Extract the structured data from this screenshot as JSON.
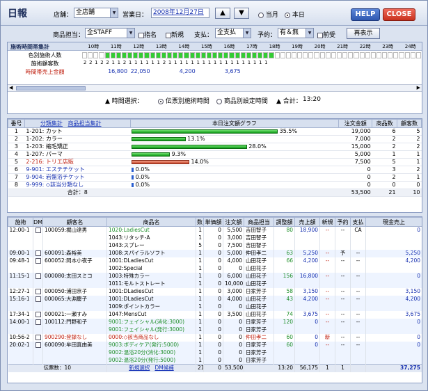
{
  "header": {
    "title": "日報",
    "store_label": "店舗：",
    "store_value": "全店舗",
    "business_day_label": "営業日：",
    "business_day_value": "2008年12月27日",
    "up_arrow": "▲",
    "down_arrow": "▼",
    "radio_month": "当月",
    "radio_today": "本日",
    "help_label": "HELP",
    "close_label": "CLOSE"
  },
  "filters": {
    "product_staff_label": "商品担当：",
    "product_staff_value": "全STAFF",
    "shimei_label": "指名",
    "shinki_label": "新規",
    "payment_label": "支払：",
    "payment_value": "全支払",
    "reserve_label": "予約：",
    "reserve_value": "有＆無",
    "maeuke_label": "前受",
    "redisplay_label": "再表示"
  },
  "timeline": {
    "title": "施術時間帯集計",
    "hours": [
      "10時",
      "11時",
      "12時",
      "13時",
      "14時",
      "15時",
      "16時",
      "17時",
      "18時",
      "19時",
      "20時",
      "21時",
      "22時",
      "23時",
      "24時"
    ],
    "row_labels": [
      "色別施術人数",
      "施術顧客数",
      "時間帯売上金額"
    ],
    "occupancy": [
      0,
      0,
      0,
      0,
      2,
      2,
      2,
      2,
      2,
      2,
      2,
      2,
      2,
      2,
      2,
      2,
      2,
      1,
      1,
      1,
      1,
      1,
      1,
      1,
      1,
      1,
      1,
      1,
      1,
      1,
      1,
      1,
      1,
      1,
      0,
      0,
      0,
      0,
      0,
      0,
      0,
      0,
      0,
      0,
      0,
      0,
      0,
      0,
      0,
      0,
      0,
      0,
      0,
      0,
      0,
      0,
      0,
      0,
      0,
      0
    ],
    "customer_counts": [
      "2",
      "2",
      "1",
      "2",
      "2",
      "1",
      "1",
      "2",
      "1",
      "1",
      "1",
      "1",
      "1",
      "1",
      "2",
      "1",
      "1",
      "1",
      "1",
      "1",
      "1",
      "1",
      "1",
      "1",
      "1",
      "1",
      "1",
      "1",
      "1",
      "1",
      "1",
      "1",
      "1"
    ],
    "sales": [
      {
        "hour_index": 1,
        "value": "16,800"
      },
      {
        "hour_index": 2,
        "value": "22,050"
      },
      {
        "hour_index": 4,
        "value": "4,200"
      },
      {
        "hour_index": 6,
        "value": "3,675"
      }
    ],
    "selector_label": "▲ 時間選択：",
    "option_slip": "伝票別施術時間",
    "option_product": "商品別設定時間",
    "total_label": "▲ 合計：",
    "total_value": "13:20"
  },
  "summary": {
    "headers": [
      "番号",
      "分類集計",
      "商品担当集計",
      "本日注文額グラフ",
      "注文金額",
      "商品数",
      "顧客数"
    ],
    "rows": [
      {
        "num": "1",
        "code": "1-201:",
        "name": "カット",
        "pct": "35.5%",
        "pct_value": 35.5,
        "bar": "green",
        "amount": "19,000",
        "items": "6",
        "customers": "5",
        "color": "black"
      },
      {
        "num": "2",
        "code": "1-202:",
        "name": "カラー",
        "pct": "13.1%",
        "pct_value": 13.1,
        "bar": "green",
        "amount": "7,000",
        "items": "2",
        "customers": "2",
        "color": "black"
      },
      {
        "num": "3",
        "code": "1-203:",
        "name": "縮毛矯正",
        "pct": "28.0%",
        "pct_value": 28.0,
        "bar": "green",
        "amount": "15,000",
        "items": "2",
        "customers": "2",
        "color": "black"
      },
      {
        "num": "4",
        "code": "1-207:",
        "name": "パーマ",
        "pct": "9.3%",
        "pct_value": 9.3,
        "bar": "green",
        "amount": "5,000",
        "items": "1",
        "customers": "1",
        "color": "black"
      },
      {
        "num": "5",
        "code": "2-216:",
        "name": "トリエ店販",
        "pct": "14.0%",
        "pct_value": 14.0,
        "bar": "red",
        "amount": "7,500",
        "items": "5",
        "customers": "1",
        "color": "red"
      },
      {
        "num": "6",
        "code": "9-901:",
        "name": "エステチケット",
        "pct": "0.0%",
        "pct_value": 0,
        "bar": "blue",
        "amount": "0",
        "items": "3",
        "customers": "2",
        "color": "blue"
      },
      {
        "num": "7",
        "code": "9-904:",
        "name": "岩盤浴チケット",
        "pct": "0.0%",
        "pct_value": 0,
        "bar": "blue",
        "amount": "0",
        "items": "2",
        "customers": "1",
        "color": "blue"
      },
      {
        "num": "8",
        "code": "9-999:",
        "name": "◇該当分類なし",
        "pct": "0.0%",
        "pct_value": 0,
        "bar": "blue",
        "amount": "0",
        "items": "0",
        "customers": "0",
        "color": "blue"
      }
    ],
    "total_label": "合計：8",
    "total_amount": "53,500",
    "total_items": "21",
    "total_customers": "10"
  },
  "detail": {
    "headers": [
      "施術",
      "DM",
      "顧客名",
      "商品名",
      "数",
      "単価額",
      "注文額",
      "商品担当",
      "調整額",
      "売上額",
      "新規",
      "予約",
      "支払",
      "現金売上"
    ],
    "rows": [
      {
        "time": "12:00-1",
        "dm": true,
        "customer": "100059:梶山達男",
        "product": "1020:LadiesCut",
        "qty": "1",
        "unit": "0",
        "order": "5,500",
        "staff": "吉田智子",
        "adj": "80",
        "sales": "18,900",
        "new": "--",
        "res": "--",
        "pay": "CA",
        "cash": "0",
        "pc": "green",
        "cc": "black",
        "sc": "black",
        "bg": "#fff"
      },
      {
        "time": "",
        "dm": false,
        "customer": "",
        "product": "1043:リタッチ-A",
        "qty": "1",
        "unit": "0",
        "order": "3,000",
        "staff": "吉田智子",
        "adj": "",
        "sales": "",
        "new": "",
        "res": "",
        "pay": "",
        "cash": "",
        "pc": "black",
        "cc": "black",
        "sc": "black",
        "bg": "#fff"
      },
      {
        "time": "",
        "dm": false,
        "customer": "",
        "product": "1043:スプレー",
        "qty": "5",
        "unit": "0",
        "order": "7,500",
        "staff": "吉田智子",
        "adj": "",
        "sales": "",
        "new": "",
        "res": "",
        "pay": "",
        "cash": "",
        "pc": "black",
        "cc": "black",
        "sc": "black",
        "bg": "#fff"
      },
      {
        "time": "09:00-1",
        "dm": true,
        "customer": "600091:森裕美",
        "product": "1008:スパイラルソフト",
        "qty": "1",
        "unit": "0",
        "order": "5,000",
        "staff": "仲田孝二",
        "adj": "63",
        "sales": "5,250",
        "new": "--",
        "res": "予",
        "pay": "--",
        "cash": "5,250",
        "pc": "black",
        "cc": "black",
        "sc": "black",
        "bg": "#eef4ff"
      },
      {
        "time": "09:48-1",
        "dm": true,
        "customer": "600052:岡本小夜子",
        "product": "1001:DLadiesCut",
        "qty": "1",
        "unit": "0",
        "order": "4,000",
        "staff": "山田花子",
        "adj": "66",
        "sales": "4,200",
        "new": "--",
        "res": "--",
        "pay": "--",
        "cash": "4,200",
        "pc": "black",
        "cc": "black",
        "sc": "black",
        "bg": "#fff"
      },
      {
        "time": "",
        "dm": false,
        "customer": "",
        "product": "1002:Special",
        "qty": "1",
        "unit": "0",
        "order": "0",
        "staff": "山田花子",
        "adj": "",
        "sales": "",
        "new": "",
        "res": "",
        "pay": "",
        "cash": "",
        "pc": "black",
        "cc": "black",
        "sc": "black",
        "bg": "#fff"
      },
      {
        "time": "11:15-1",
        "dm": true,
        "customer": "000080:太田スミコ",
        "product": "1003:特殊カラー",
        "qty": "1",
        "unit": "0",
        "order": "6,000",
        "staff": "山田花子",
        "adj": "156",
        "sales": "16,800",
        "new": "--",
        "res": "--",
        "pay": "--",
        "cash": "0",
        "pc": "black",
        "cc": "black",
        "sc": "black",
        "bg": "#eef4ff"
      },
      {
        "time": "",
        "dm": false,
        "customer": "",
        "product": "1011:モルトストレート",
        "qty": "1",
        "unit": "0",
        "order": "10,000",
        "staff": "山田花子",
        "adj": "",
        "sales": "",
        "new": "",
        "res": "",
        "pay": "",
        "cash": "",
        "pc": "black",
        "cc": "black",
        "sc": "black",
        "bg": "#eef4ff"
      },
      {
        "time": "12:27-1",
        "dm": true,
        "customer": "000050:浦田京子",
        "product": "1001:DLadiesCut",
        "qty": "1",
        "unit": "0",
        "order": "3,000",
        "staff": "日家芳子",
        "adj": "58",
        "sales": "3,150",
        "new": "--",
        "res": "--",
        "pay": "--",
        "cash": "3,150",
        "pc": "black",
        "cc": "black",
        "sc": "black",
        "bg": "#fff"
      },
      {
        "time": "15:16-1",
        "dm": true,
        "customer": "000065:大淵慶子",
        "product": "1001:DLadiesCut",
        "qty": "1",
        "unit": "0",
        "order": "4,000",
        "staff": "山田花子",
        "adj": "43",
        "sales": "4,200",
        "new": "--",
        "res": "--",
        "pay": "--",
        "cash": "4,200",
        "pc": "black",
        "cc": "black",
        "sc": "black",
        "bg": "#eef4ff"
      },
      {
        "time": "",
        "dm": false,
        "customer": "",
        "product": "1009:ポイントカラー",
        "qty": "1",
        "unit": "0",
        "order": "0",
        "staff": "山田花子",
        "adj": "",
        "sales": "",
        "new": "",
        "res": "",
        "pay": "",
        "cash": "",
        "pc": "black",
        "cc": "black",
        "sc": "black",
        "bg": "#eef4ff"
      },
      {
        "time": "17:34-1",
        "dm": true,
        "customer": "000021:一瀬すみ",
        "product": "1047:MensCut",
        "qty": "1",
        "unit": "0",
        "order": "3,500",
        "staff": "山田花子",
        "adj": "74",
        "sales": "3,675",
        "new": "--",
        "res": "--",
        "pay": "--",
        "cash": "3,675",
        "pc": "black",
        "cc": "black",
        "sc": "black",
        "bg": "#fff"
      },
      {
        "time": "14:00-1",
        "dm": true,
        "customer": "100112:門野和子",
        "product": "9001:フェイシャル(消化:3000)",
        "qty": "1",
        "unit": "0",
        "order": "0",
        "staff": "日家芳子",
        "adj": "120",
        "sales": "0",
        "new": "--",
        "res": "--",
        "pay": "--",
        "cash": "0",
        "pc": "green",
        "cc": "black",
        "sc": "black",
        "bg": "#eef4ff"
      },
      {
        "time": "",
        "dm": false,
        "customer": "",
        "product": "9001:フェイシャル(発行:3000)",
        "qty": "1",
        "unit": "0",
        "order": "0",
        "staff": "日家芳子",
        "adj": "",
        "sales": "",
        "new": "",
        "res": "",
        "pay": "",
        "cash": "",
        "pc": "green",
        "cc": "black",
        "sc": "black",
        "bg": "#eef4ff"
      },
      {
        "time": "10:56-2",
        "dm": true,
        "customer": "900290:登録なし",
        "product": "0000:◇該当商品なし",
        "qty": "1",
        "unit": "0",
        "order": "0",
        "staff": "仲田孝二",
        "adj": "60",
        "sales": "0",
        "new": "新",
        "res": "--",
        "pay": "--",
        "cash": "0",
        "pc": "red",
        "cc": "red",
        "sc": "red",
        "bg": "#fff"
      },
      {
        "time": "20:02-1",
        "dm": true,
        "customer": "600090:牟田真由美",
        "product": "9003:ボディケア(発行:5000)",
        "qty": "1",
        "unit": "0",
        "order": "0",
        "staff": "日家芳子",
        "adj": "60",
        "sales": "0",
        "new": "--",
        "res": "--",
        "pay": "--",
        "cash": "0",
        "pc": "green",
        "cc": "black",
        "sc": "black",
        "bg": "#eef4ff"
      },
      {
        "time": "",
        "dm": false,
        "customer": "",
        "product": "9002:温浴20分(消化:3000)",
        "qty": "1",
        "unit": "0",
        "order": "0",
        "staff": "日家芳子",
        "adj": "",
        "sales": "",
        "new": "",
        "res": "",
        "pay": "",
        "cash": "",
        "pc": "green",
        "cc": "black",
        "sc": "black",
        "bg": "#eef4ff"
      },
      {
        "time": "",
        "dm": false,
        "customer": "",
        "product": "9002:温浴20分(発行:5000)",
        "qty": "1",
        "unit": "0",
        "order": "0",
        "staff": "日家芳子",
        "adj": "",
        "sales": "",
        "new": "",
        "res": "",
        "pay": "",
        "cash": "",
        "pc": "green",
        "cc": "black",
        "sc": "black",
        "bg": "#eef4ff"
      }
    ],
    "footer": {
      "slips_label": "伝票数：10",
      "new_select": "新規選択",
      "dm_candidate": "DM候補",
      "qty_total": "21",
      "unit_total": "0",
      "order_total": "53,500",
      "time_total": "13:20",
      "sales_total": "56,175",
      "new_total": "1",
      "res_total": "1",
      "cash_total": "37,275"
    }
  },
  "colors": {
    "accent": "#1c2d5a",
    "green_bar": "#109a18",
    "red_bar": "#c6442a",
    "blue_bar": "#2a5fd0",
    "occupied": "#33cc33"
  }
}
